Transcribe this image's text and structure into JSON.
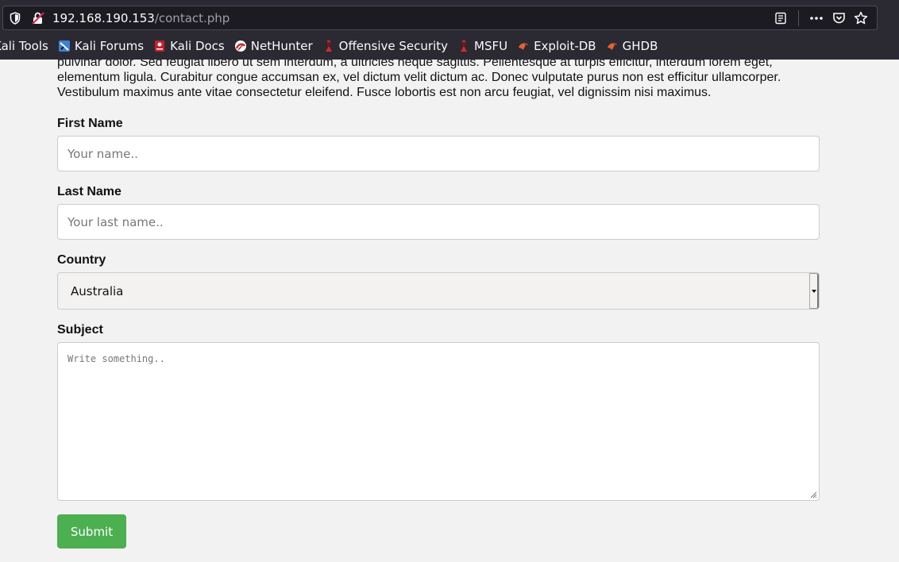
{
  "browser": {
    "url_host": "192.168.190.153",
    "url_path": "/contact.php",
    "bookmarks": [
      {
        "label": "Kali Tools",
        "icon": "kali-tools-icon"
      },
      {
        "label": "Kali Forums",
        "icon": "kali-forums-icon"
      },
      {
        "label": "Kali Docs",
        "icon": "kali-docs-icon"
      },
      {
        "label": "NetHunter",
        "icon": "nethunter-icon"
      },
      {
        "label": "Offensive Security",
        "icon": "offensive-security-icon"
      },
      {
        "label": "MSFU",
        "icon": "msfu-icon"
      },
      {
        "label": "Exploit-DB",
        "icon": "exploit-db-icon"
      },
      {
        "label": "GHDB",
        "icon": "ghdb-icon"
      }
    ]
  },
  "page": {
    "intro_lines": [
      "pulvinar dolor. Sed feugiat libero ut sem interdum, a ultricies neque sagittis. Pellentesque at turpis efficitur, interdum lorem eget,",
      "elementum ligula. Curabitur congue accumsan ex, vel dictum velit dictum ac. Donec vulputate purus non est efficitur ullamcorper.",
      "Vestibulum maximus ante vitae consectetur eleifend. Fusce lobortis est non arcu feugiat, vel dignissim nisi maximus."
    ],
    "form": {
      "first_name_label": "First Name",
      "first_name_placeholder": "Your name..",
      "last_name_label": "Last Name",
      "last_name_placeholder": "Your last name..",
      "country_label": "Country",
      "country_value": "Australia",
      "subject_label": "Subject",
      "subject_placeholder": "Write something..",
      "submit_label": "Submit"
    }
  },
  "colors": {
    "submit": "#4caf50",
    "chrome": "#2b2a33"
  }
}
